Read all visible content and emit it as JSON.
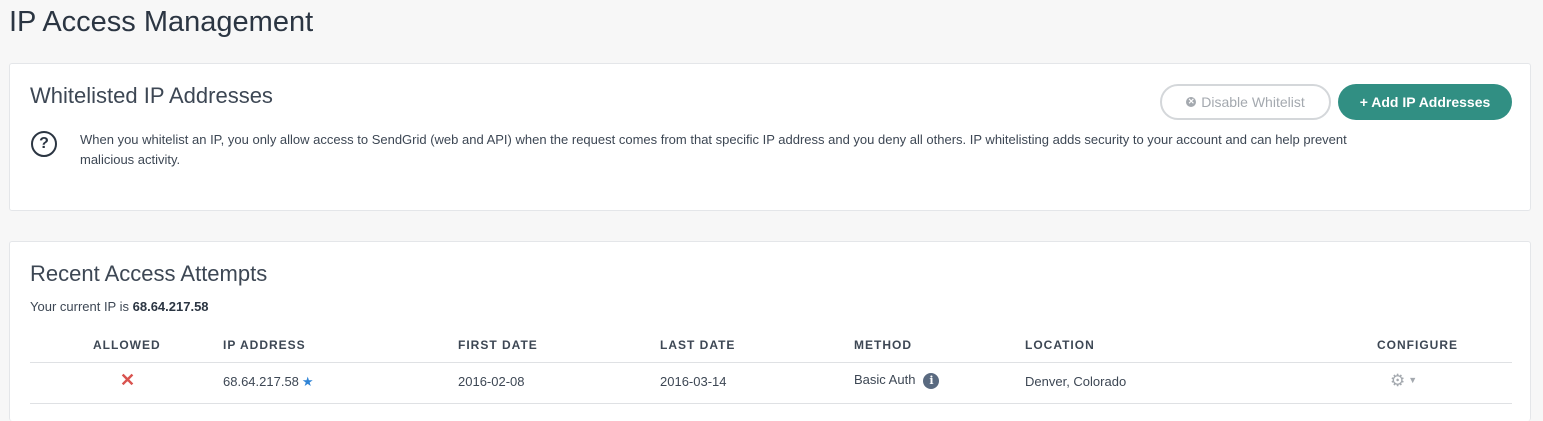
{
  "page": {
    "title": "IP Access Management"
  },
  "whitelist": {
    "title": "Whitelisted IP Addresses",
    "disable_button": "Disable Whitelist",
    "add_button": "+ Add IP Addresses",
    "help_text": "When you whitelist an IP, you only allow access to SendGrid (web and API) when the request comes from that specific IP address and you deny all others. IP whitelisting adds security to your account and can help prevent malicious activity."
  },
  "recent": {
    "title": "Recent Access Attempts",
    "current_ip_prefix": "Your current IP is",
    "current_ip": "68.64.217.58",
    "columns": [
      "ALLOWED",
      "IP ADDRESS",
      "FIRST DATE",
      "LAST DATE",
      "METHOD",
      "LOCATION",
      "CONFIGURE"
    ],
    "rows": [
      {
        "allowed_icon": "x-icon",
        "ip": "68.64.217.58",
        "first_date": "2016-02-08",
        "last_date": "2016-03-14",
        "method": "Basic Auth",
        "location": "Denver, Colorado"
      }
    ]
  },
  "colors": {
    "accent": "#318f83",
    "deny": "#d9534f",
    "star": "#2f84d6"
  }
}
